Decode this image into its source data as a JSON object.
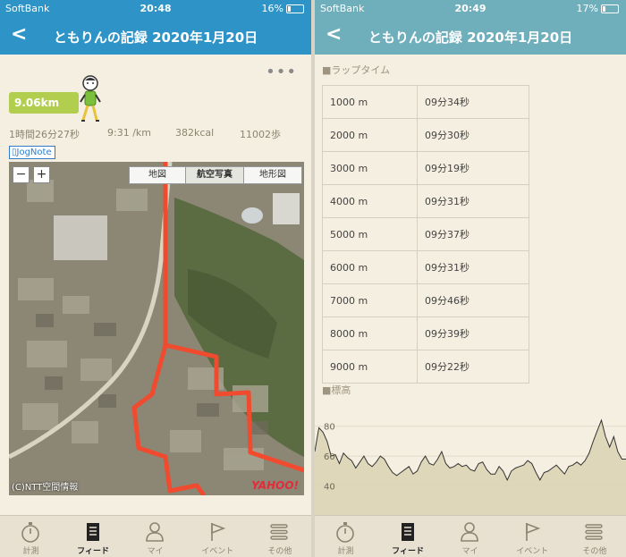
{
  "left": {
    "status": {
      "carrier": "SoftBank",
      "time": "20:48",
      "battery": "16%"
    },
    "nav": {
      "back": "<",
      "title": "ともりんの記録 2020年1月20日"
    },
    "more": "•••",
    "distance": "9.06km",
    "stats": {
      "duration": "1時間26分27秒",
      "pace": "9:31 /km",
      "calories": "382kcal",
      "steps": "11002歩"
    },
    "jognote": "JogNote",
    "map": {
      "zoom_out": "−",
      "zoom_in": "+",
      "tabs": [
        "地図",
        "航空写真",
        "地形図"
      ],
      "active_tab": "航空写真",
      "credit": "(C)NTT空間情報",
      "logo": "YAHOO!",
      "route_color": "#f04a2f"
    }
  },
  "right": {
    "status": {
      "carrier": "SoftBank",
      "time": "20:49",
      "battery": "17%"
    },
    "nav": {
      "back": "<",
      "title": "ともりんの記録 2020年1月20日"
    },
    "laps_title": "■ラップタイム",
    "laps": [
      {
        "dist": "1000 m",
        "time": "09分34秒"
      },
      {
        "dist": "2000 m",
        "time": "09分30秒"
      },
      {
        "dist": "3000 m",
        "time": "09分19秒"
      },
      {
        "dist": "4000 m",
        "time": "09分31秒"
      },
      {
        "dist": "5000 m",
        "time": "09分37秒"
      },
      {
        "dist": "6000 m",
        "time": "09分31秒"
      },
      {
        "dist": "7000 m",
        "time": "09分46秒"
      },
      {
        "dist": "8000 m",
        "time": "09分39秒"
      },
      {
        "dist": "9000 m",
        "time": "09分22秒"
      }
    ],
    "elev_title": "■標高",
    "elev_ticks": [
      "80",
      "60",
      "40"
    ],
    "elev_ylim": [
      20,
      90
    ]
  },
  "tabs": [
    {
      "label": "計測",
      "icon": "stopwatch-icon"
    },
    {
      "label": "フィード",
      "icon": "feed-icon"
    },
    {
      "label": "マイ",
      "icon": "person-icon"
    },
    {
      "label": "イベント",
      "icon": "flag-icon"
    },
    {
      "label": "その他",
      "icon": "menu-icon"
    }
  ],
  "active_tab": "フィード",
  "chart_data": {
    "type": "area",
    "title": "■標高",
    "xlabel": "",
    "ylabel": "",
    "ylim": [
      20,
      90
    ],
    "yticks": [
      80,
      60,
      40
    ],
    "series": [
      {
        "values": [
          63,
          79,
          76,
          70,
          60,
          61,
          55,
          62,
          59,
          57,
          52,
          56,
          60,
          55,
          53,
          56,
          60,
          58,
          53,
          49,
          47,
          49,
          51,
          53,
          48,
          50,
          56,
          60,
          55,
          54,
          58,
          63,
          55,
          52,
          53,
          55,
          53,
          54,
          51,
          50,
          55,
          56,
          51,
          48,
          48,
          53,
          50,
          44,
          50,
          52,
          53,
          54,
          57,
          55,
          49,
          44,
          49,
          50,
          52,
          54,
          51,
          48,
          53,
          54,
          56,
          54,
          57,
          62,
          70,
          77,
          84,
          73,
          66,
          73,
          63,
          58,
          58
        ]
      }
    ]
  }
}
